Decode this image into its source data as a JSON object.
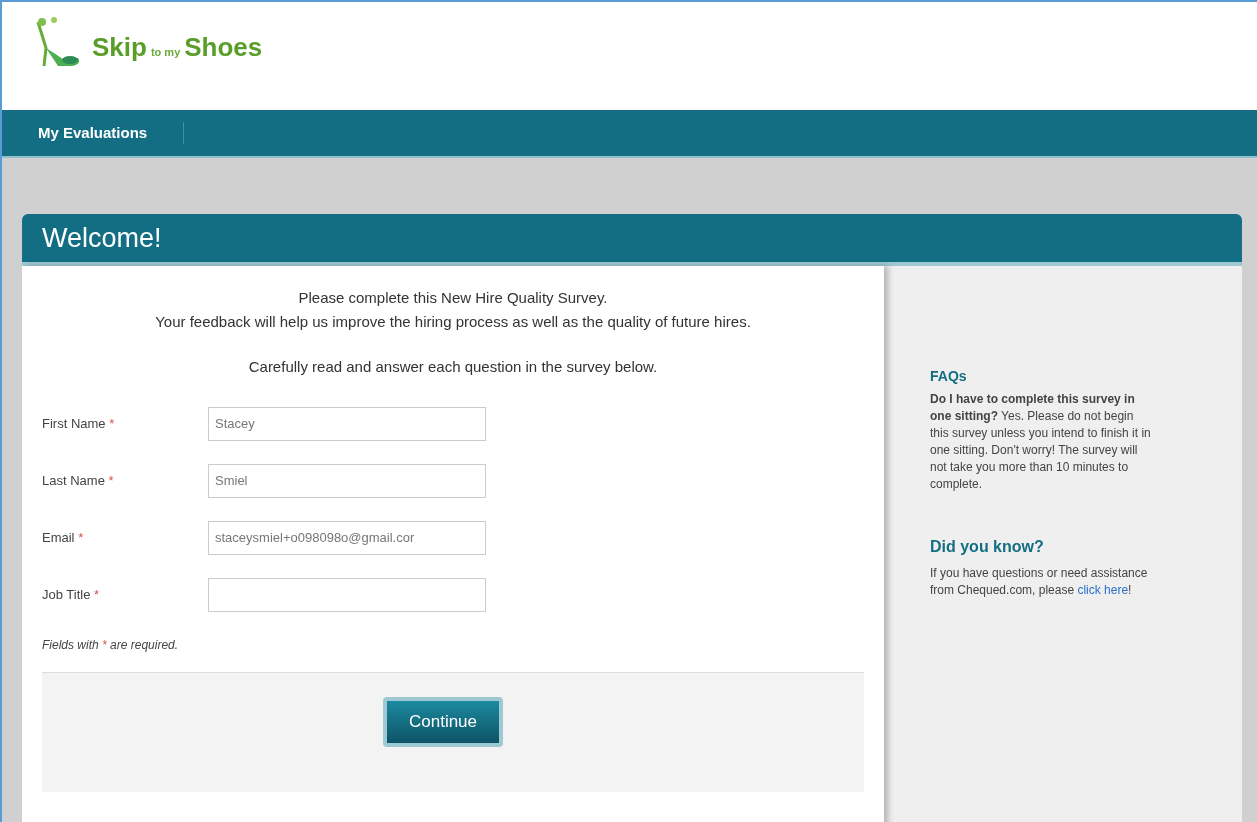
{
  "logo": {
    "parts": [
      "Skip",
      "to my",
      "Shoes"
    ]
  },
  "nav": [
    {
      "label": "My Evaluations",
      "selected": true
    }
  ],
  "card": {
    "title": "Welcome!",
    "intro": [
      "Please complete this New Hire Quality Survey.",
      "Your feedback will help us improve the hiring process as well as the quality of future hires."
    ],
    "instruction": "Carefully read and answer each question in the survey below.",
    "fields": [
      {
        "label": "First Name",
        "required_mark": "*",
        "value": "Stacey"
      },
      {
        "label": "Last Name",
        "required_mark": "*",
        "value": "Smiel"
      },
      {
        "label": "Email",
        "required_mark": "*",
        "value": "staceysmiel+o098098o@gmail.cor"
      },
      {
        "label": "Job Title",
        "required_mark": "*"
      }
    ],
    "note": {
      "before": "Fields with",
      "mark": "*",
      "after": "are required."
    },
    "button": "Continue"
  },
  "sidebar": {
    "faq_title": "FAQs",
    "faq_text": "**Do I have to complete this survey in one sitting?** Yes. Please do not begin this survey unless you intend to finish it in one sitting. Don't worry! The survey will not take you more than 10 minutes to complete.",
    "know_title": "Did you know?",
    "know_before": "If you have questions or need assistance from Chequed.com, please",
    "know_link": "click here",
    "know_after": "!"
  }
}
